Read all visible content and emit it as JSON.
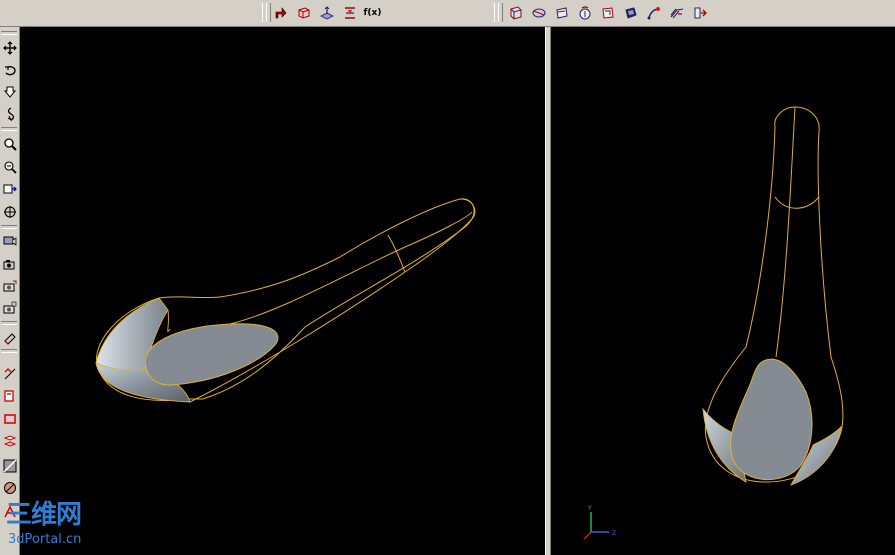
{
  "toolbar_top": {
    "group1_icons": [
      "sketch-arrow-icon",
      "extrude-box-icon",
      "plane-icon",
      "datum-plane-icon",
      "formula-icon"
    ],
    "formula_label": "f(x)",
    "group2_icons": [
      "surface-box-icon",
      "surface-revolve-icon",
      "surface-sweep-icon",
      "surface-loft-icon",
      "surface-fill-icon",
      "surface-offset-icon",
      "surface-blend-icon",
      "surface-extend-icon",
      "surface-split-icon"
    ]
  },
  "toolbar_left": {
    "icons": [
      "pan-icon",
      "rotate-icon",
      "zoom-in-out-icon",
      "spin-icon",
      "magnifier-icon",
      "zoom-window-icon",
      "fit-all-icon",
      "normal-view-icon",
      "view-options-icon",
      "camera-icon",
      "camera-2-icon",
      "camera-3-icon",
      "layer-icon",
      "sketch-icon",
      "constraint-icon",
      "rectangle-icon",
      "mirror-icon",
      "shading-icon",
      "circle-icon",
      "text-icon"
    ]
  },
  "viewports": {
    "left": {
      "name": "perspective-view"
    },
    "right": {
      "name": "front-view",
      "axis_labels": {
        "y": "Y",
        "z": "Z"
      }
    }
  },
  "watermark": {
    "text_cn": "三维网",
    "text_en": "3dPortal.cn"
  },
  "colors": {
    "background": "#000000",
    "edge": "#e0b030",
    "surface": "#8a9098",
    "chrome": "#d4d0c8"
  }
}
